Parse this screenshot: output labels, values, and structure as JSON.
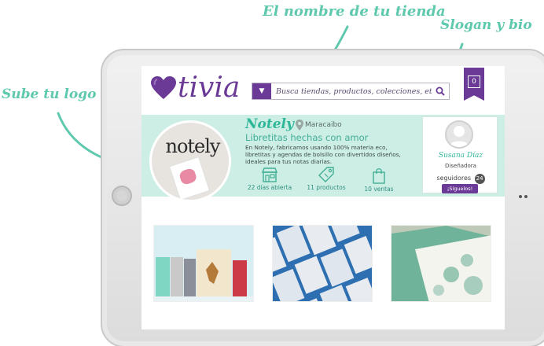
{
  "annotations": {
    "store_name": "El nombre de tu tienda",
    "slogan_bio": "Slogan y bio",
    "logo": "Sube tu logo"
  },
  "header": {
    "brand": "tivia",
    "search_placeholder": "Busca tiendas, productos, colecciones, etc",
    "cart_count": "0"
  },
  "store": {
    "logo_text": "notely",
    "name": "Notely",
    "city": "Maracaibo",
    "slogan": "Libretitas hechas con amor",
    "bio": "En Notely, fabricamos  usando 100% materia eco, libretitas y agendas de bolsillo con divertidos diseños, ideales para tus notas  diarias.",
    "stats": [
      {
        "icon": "store-icon",
        "label": "22 días abierta"
      },
      {
        "icon": "tag-icon",
        "label": "11 productos"
      },
      {
        "icon": "bag-icon",
        "label": "10 ventas"
      }
    ]
  },
  "owner": {
    "name": "Susana Díaz",
    "role": "Diseñadora",
    "followers_label": "seguidores",
    "followers_count": "24",
    "follow_button": "¡Síguelos!"
  },
  "colors": {
    "brand_purple": "#6a3a96",
    "banner_mint": "#cdeee5",
    "accent_teal": "#2fb79a",
    "annotation_green": "#5ec9ad"
  }
}
